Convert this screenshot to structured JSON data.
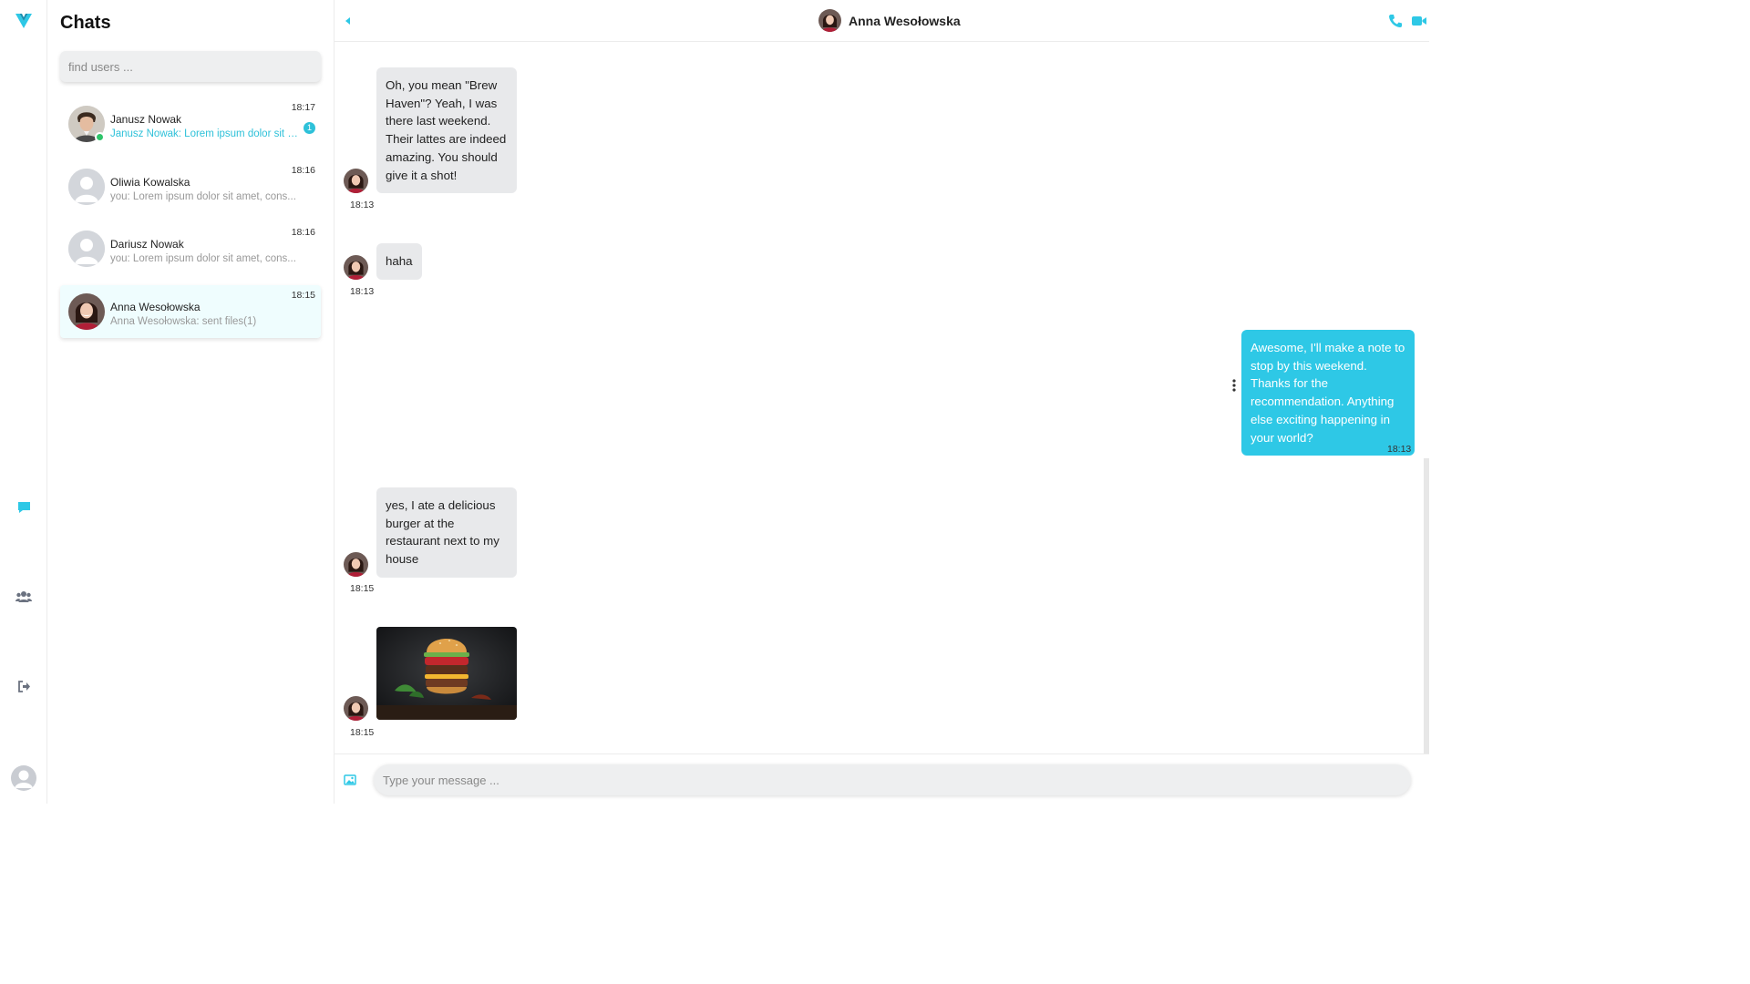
{
  "colors": {
    "accent": "#2ec8e6",
    "online": "#2ec46a",
    "incoming_bubble": "#e8e9eb"
  },
  "rail": {
    "icons": [
      "logo-v-icon",
      "chat-bubble-icon",
      "users-icon",
      "logout-icon",
      "user-avatar-icon"
    ]
  },
  "sidebar": {
    "title": "Chats",
    "search_placeholder": "find users ...",
    "chats": [
      {
        "name": "Janusz Nowak",
        "preview": "Janusz Nowak: Lorem ipsum dolor sit a...",
        "time": "18:17",
        "unread": "1",
        "online": true
      },
      {
        "name": "Oliwia Kowalska",
        "preview": "you: Lorem ipsum dolor sit amet, cons...",
        "time": "18:16"
      },
      {
        "name": "Dariusz Nowak",
        "preview": "you: Lorem ipsum dolor sit amet, cons...",
        "time": "18:16"
      },
      {
        "name": "Anna Wesołowska",
        "preview": "Anna Wesołowska: sent files(1)",
        "time": "18:15",
        "active": true
      }
    ]
  },
  "conversation": {
    "peer_name": "Anna Wesołowska",
    "messages": [
      {
        "from": "peer",
        "text": "Oh, you mean \"Brew Haven\"? Yeah, I was there last weekend. Their lattes are indeed amazing. You should give it a shot!",
        "time": "18:13"
      },
      {
        "from": "peer",
        "text": "haha",
        "time": "18:13"
      },
      {
        "from": "me",
        "text": "Awesome, I'll make a note to stop by this weekend. Thanks for the recommendation. Anything else exciting happening in your world?",
        "time": "18:13"
      },
      {
        "from": "peer",
        "text": "yes, I ate a delicious burger at the restaurant next to my house",
        "time": "18:15"
      },
      {
        "from": "peer",
        "image": "burger-photo",
        "time": "18:15"
      }
    ],
    "input_placeholder": "Type your message ..."
  }
}
